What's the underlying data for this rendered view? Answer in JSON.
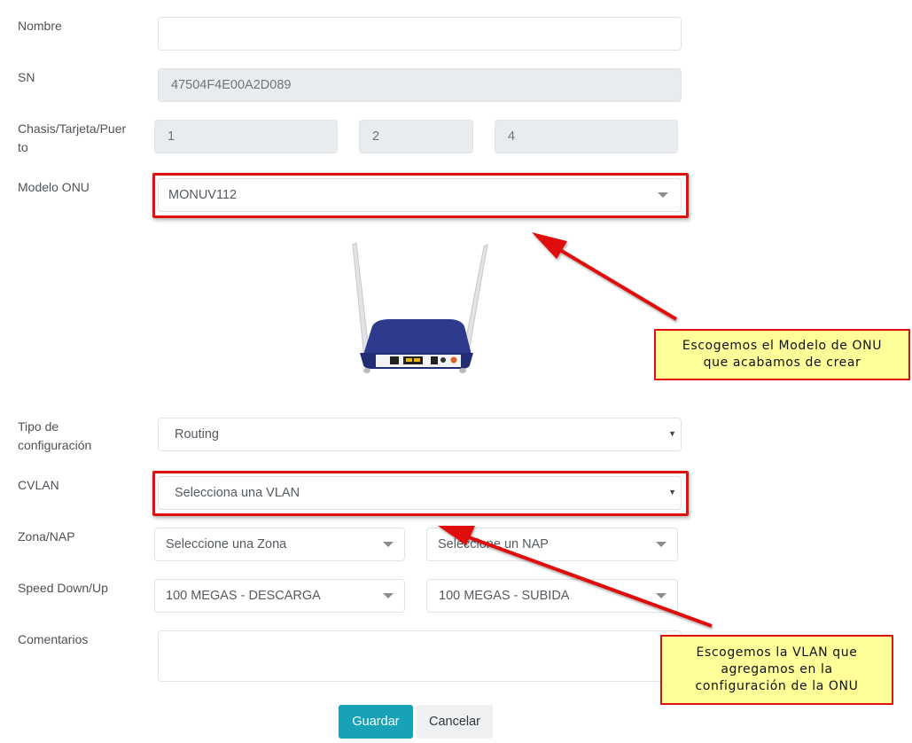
{
  "form": {
    "nombre": {
      "label": "Nombre",
      "value": ""
    },
    "sn": {
      "label": "SN",
      "value": "47504F4E00A2D089"
    },
    "chasis": {
      "label_line1": "Chasis/Tarjeta/Puer",
      "label_line2": "to",
      "chasis": "1",
      "tarjeta": "2",
      "puerto": "4"
    },
    "modelo": {
      "label": "Modelo ONU",
      "value": "MONUV112"
    },
    "tipo": {
      "label_line1": "Tipo de",
      "label_line2": "configuración",
      "value": "Routing"
    },
    "cvlan": {
      "label": "CVLAN",
      "value": "Selecciona una VLAN"
    },
    "zona_nap": {
      "label": "Zona/NAP",
      "zona": "Seleccione una Zona",
      "nap": "Seleccione un NAP"
    },
    "speed": {
      "label": "Speed Down/Up",
      "down": "100 MEGAS - DESCARGA",
      "up": "100 MEGAS - SUBIDA"
    },
    "comentarios": {
      "label": "Comentarios",
      "value": ""
    },
    "buttons": {
      "save": "Guardar",
      "cancel": "Cancelar"
    }
  },
  "annotations": {
    "callout_modelo": {
      "line1": "Escogemos el Modelo de ONU",
      "line2": "que acabamos de crear"
    },
    "callout_vlan": {
      "line1": "Escogemos la VLAN que",
      "line2": "agregamos en la",
      "line3": "configuración de la ONU"
    }
  },
  "colors": {
    "primary": "#17a2b8",
    "highlight": "#e01010",
    "callout_bg": "#ffff99",
    "readonly_bg": "#e9ecef"
  },
  "icons": {
    "select_caret": "caret-down-icon"
  }
}
